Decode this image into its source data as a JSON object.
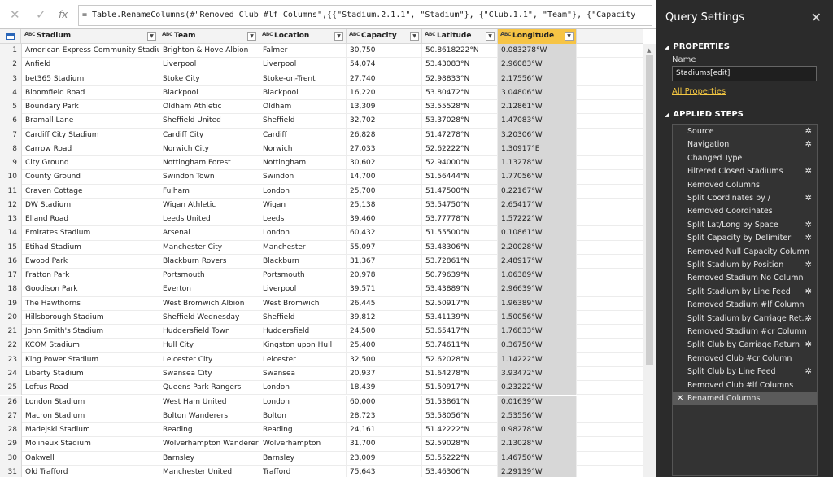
{
  "formula_bar": {
    "cancel_icon": "✕",
    "confirm_icon": "✓",
    "fx_label": "fx",
    "formula": "= Table.RenameColumns(#\"Removed Club #lf Columns\",{{\"Stadium.2.1.1\", \"Stadium\"}, {\"Club.1.1\", \"Team\"}, {\"Capacity"
  },
  "grid": {
    "columns": [
      {
        "type": "ABC",
        "name": "Stadium"
      },
      {
        "type": "ABC",
        "name": "Team"
      },
      {
        "type": "ABC",
        "name": "Location"
      },
      {
        "type": "ABC",
        "name": "Capacity"
      },
      {
        "type": "ABC",
        "name": "Latitude"
      },
      {
        "type": "ABC",
        "name": "Longitude"
      }
    ],
    "rows": [
      [
        "1",
        "American Express Community Stadium",
        "Brighton & Hove Albion",
        "Falmer",
        "30,750",
        "50.8618222°N",
        "0.083278°W"
      ],
      [
        "2",
        "Anfield",
        "Liverpool",
        "Liverpool",
        "54,074",
        "53.43083°N",
        "2.96083°W"
      ],
      [
        "3",
        "bet365 Stadium",
        "Stoke City",
        "Stoke-on-Trent",
        "27,740",
        "52.98833°N",
        "2.17556°W"
      ],
      [
        "4",
        "Bloomfield Road",
        "Blackpool",
        "Blackpool",
        "16,220",
        "53.80472°N",
        "3.04806°W"
      ],
      [
        "5",
        "Boundary Park",
        "Oldham Athletic",
        "Oldham",
        "13,309",
        "53.55528°N",
        "2.12861°W"
      ],
      [
        "6",
        "Bramall Lane",
        "Sheffield United",
        "Sheffield",
        "32,702",
        "53.37028°N",
        "1.47083°W"
      ],
      [
        "7",
        "Cardiff City Stadium",
        "Cardiff City",
        "Cardiff",
        "26,828",
        "51.47278°N",
        "3.20306°W"
      ],
      [
        "8",
        "Carrow Road",
        "Norwich City",
        "Norwich",
        "27,033",
        "52.62222°N",
        "1.30917°E"
      ],
      [
        "9",
        "City Ground",
        "Nottingham Forest",
        "Nottingham",
        "30,602",
        "52.94000°N",
        "1.13278°W"
      ],
      [
        "10",
        "County Ground",
        "Swindon Town",
        "Swindon",
        "14,700",
        "51.56444°N",
        "1.77056°W"
      ],
      [
        "11",
        "Craven Cottage",
        "Fulham",
        "London",
        "25,700",
        "51.47500°N",
        "0.22167°W"
      ],
      [
        "12",
        "DW Stadium",
        "Wigan Athletic",
        "Wigan",
        "25,138",
        "53.54750°N",
        "2.65417°W"
      ],
      [
        "13",
        "Elland Road",
        "Leeds United",
        "Leeds",
        "39,460",
        "53.77778°N",
        "1.57222°W"
      ],
      [
        "14",
        "Emirates Stadium",
        "Arsenal",
        "London",
        "60,432",
        "51.55500°N",
        "0.10861°W"
      ],
      [
        "15",
        "Etihad Stadium",
        "Manchester City",
        "Manchester",
        "55,097",
        "53.48306°N",
        "2.20028°W"
      ],
      [
        "16",
        "Ewood Park",
        "Blackburn Rovers",
        "Blackburn",
        "31,367",
        "53.72861°N",
        "2.48917°W"
      ],
      [
        "17",
        "Fratton Park",
        "Portsmouth",
        "Portsmouth",
        "20,978",
        "50.79639°N",
        "1.06389°W"
      ],
      [
        "18",
        "Goodison Park",
        "Everton",
        "Liverpool",
        "39,571",
        "53.43889°N",
        "2.96639°W"
      ],
      [
        "19",
        "The Hawthorns",
        "West Bromwich Albion",
        "West Bromwich",
        "26,445",
        "52.50917°N",
        "1.96389°W"
      ],
      [
        "20",
        "Hillsborough Stadium",
        "Sheffield Wednesday",
        "Sheffield",
        "39,812",
        "53.41139°N",
        "1.50056°W"
      ],
      [
        "21",
        "John Smith's Stadium",
        "Huddersfield Town",
        "Huddersfield",
        "24,500",
        "53.65417°N",
        "1.76833°W"
      ],
      [
        "22",
        "KCOM Stadium",
        "Hull City",
        "Kingston upon Hull",
        "25,400",
        "53.74611°N",
        "0.36750°W"
      ],
      [
        "23",
        "King Power Stadium",
        "Leicester City",
        "Leicester",
        "32,500",
        "52.62028°N",
        "1.14222°W"
      ],
      [
        "24",
        "Liberty Stadium",
        "Swansea City",
        "Swansea",
        "20,937",
        "51.64278°N",
        "3.93472°W"
      ],
      [
        "25",
        "Loftus Road",
        "Queens Park Rangers",
        "London",
        "18,439",
        "51.50917°N",
        "0.23222°W"
      ],
      [
        "26",
        "London Stadium",
        "West Ham United",
        "London",
        "60,000",
        "51.53861°N",
        "0.01639°W"
      ],
      [
        "27",
        "Macron Stadium",
        "Bolton Wanderers",
        "Bolton",
        "28,723",
        "53.58056°N",
        "2.53556°W"
      ],
      [
        "28",
        "Madejski Stadium",
        "Reading",
        "Reading",
        "24,161",
        "51.42222°N",
        "0.98278°W"
      ],
      [
        "29",
        "Molineux Stadium",
        "Wolverhampton Wanderers",
        "Wolverhampton",
        "31,700",
        "52.59028°N",
        "2.13028°W"
      ],
      [
        "30",
        "Oakwell",
        "Barnsley",
        "Barnsley",
        "23,009",
        "53.55222°N",
        "1.46750°W"
      ],
      [
        "31",
        "Old Trafford",
        "Manchester United",
        "Trafford",
        "75,643",
        "53.46306°N",
        "2.29139°W"
      ]
    ]
  },
  "query_settings": {
    "title": "Query Settings",
    "close_icon": "✕",
    "properties_title": "PROPERTIES",
    "name_label": "Name",
    "name_value": "Stadiums[edit]",
    "all_properties": "All Properties",
    "applied_steps_title": "APPLIED STEPS",
    "steps": [
      {
        "label": "Source",
        "gear": true
      },
      {
        "label": "Navigation",
        "gear": true
      },
      {
        "label": "Changed Type",
        "gear": false
      },
      {
        "label": "Filtered Closed Stadiums",
        "gear": true
      },
      {
        "label": "Removed Columns",
        "gear": false
      },
      {
        "label": "Split Coordinates by /",
        "gear": true
      },
      {
        "label": "Removed Coordinates",
        "gear": false
      },
      {
        "label": "Split Lat/Long by Space",
        "gear": true
      },
      {
        "label": "Split Capacity by Delimiter",
        "gear": true
      },
      {
        "label": "Removed Null Capacity Column",
        "gear": false
      },
      {
        "label": "Split Stadium by Position",
        "gear": true
      },
      {
        "label": "Removed Stadium No Column",
        "gear": false
      },
      {
        "label": "Split Stadium by Line Feed",
        "gear": true
      },
      {
        "label": "Removed Stadium #lf Column",
        "gear": false
      },
      {
        "label": "Split Stadium by Carriage Ret...",
        "gear": true
      },
      {
        "label": "Removed Stadium #cr Column",
        "gear": false
      },
      {
        "label": "Split Club by Carriage Return",
        "gear": true
      },
      {
        "label": "Removed Club #cr Column",
        "gear": false
      },
      {
        "label": "Split Club by Line Feed",
        "gear": true
      },
      {
        "label": "Removed Club #lf Columns",
        "gear": false
      },
      {
        "label": "Renamed Columns",
        "gear": false,
        "selected": true
      }
    ],
    "gear_icon": "✲",
    "delete_icon": "✕"
  },
  "colors": {
    "selected_column": "#f6c445",
    "link": "#f5c842",
    "panel_bg": "#2b2b2b"
  }
}
